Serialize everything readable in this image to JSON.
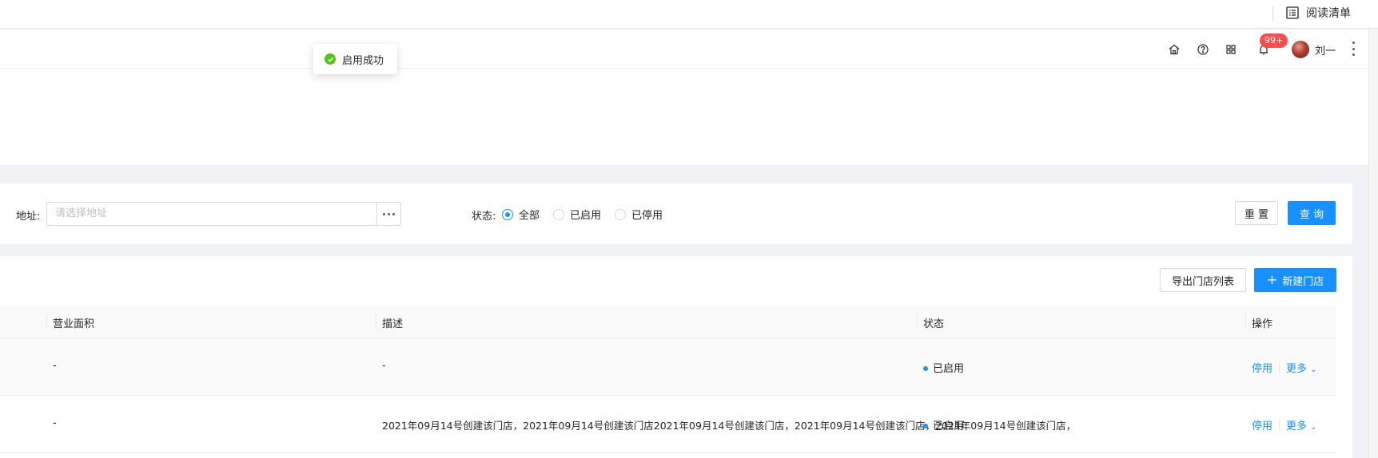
{
  "topbar": {
    "reading_list": "阅读清单"
  },
  "header": {
    "notification_badge": "99+",
    "user_name": "刘一",
    "icons": [
      "home-icon",
      "help-icon",
      "apps-icon",
      "bell-icon",
      "more-vertical-icon"
    ]
  },
  "toast": {
    "message": "启用成功",
    "type": "success"
  },
  "filter": {
    "address_label": "地址:",
    "address_placeholder": "请选择地址",
    "status_label": "状态:",
    "status_options": [
      "全部",
      "已启用",
      "已停用"
    ],
    "status_selected": "全部",
    "reset_label": "重 置",
    "query_label": "查 询"
  },
  "toolbar": {
    "export_label": "导出门店列表",
    "new_store_label": "新建门店"
  },
  "table": {
    "columns": [
      "营业面积",
      "描述",
      "状态",
      "操作"
    ],
    "rows": [
      {
        "area": "-",
        "description": "-",
        "status": "已启用",
        "action_disable": "停用",
        "action_more": "更多"
      },
      {
        "area": "-",
        "description": "2021年09月14号创建该门店，2021年09月14号创建该门店2021年09月14号创建该门店，2021年09月14号创建该门店，2021年09月14号创建该门店，",
        "status": "已启用",
        "action_disable": "停用",
        "action_more": "更多"
      }
    ]
  },
  "colors": {
    "primary": "#1890ff",
    "success": "#52c41a",
    "badge": "#ff4d4f"
  }
}
